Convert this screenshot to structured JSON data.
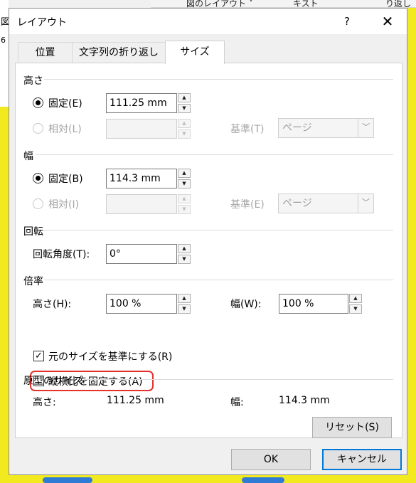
{
  "background": {
    "ribbon_item_1": "図のレイアウト ˅",
    "ribbon_item_2": "キスト",
    "ribbon_item_3": "り返し",
    "left_chars": [
      "図",
      "6"
    ]
  },
  "dialog": {
    "title": "レイアウト",
    "help_label": "?",
    "close_label": "✕"
  },
  "tabs": [
    {
      "label": "位置"
    },
    {
      "label": "文字列の折り返し"
    },
    {
      "label": "サイズ"
    }
  ],
  "height_section": {
    "title": "高さ",
    "fixed_label": "固定(E)",
    "fixed_value": "111.25 mm",
    "relative_label": "相対(L)",
    "relative_value": "",
    "base_label": "基準(T)",
    "base_value": "ページ"
  },
  "width_section": {
    "title": "幅",
    "fixed_label": "固定(B)",
    "fixed_value": "114.3 mm",
    "relative_label": "相対(I)",
    "relative_value": "",
    "base_label": "基準(E)",
    "base_value": "ページ"
  },
  "rotation_section": {
    "title": "回転",
    "angle_label": "回転角度(T):",
    "angle_value": "0°"
  },
  "scale_section": {
    "title": "倍率",
    "height_label": "高さ(H):",
    "height_value": "100 %",
    "width_label": "幅(W):",
    "width_value": "100 %",
    "lock_aspect_label": "縦横比を固定する(A)",
    "lock_aspect_checked": false,
    "relative_original_label": "元のサイズを基準にする(R)",
    "relative_original_checked": true
  },
  "original_size_section": {
    "title": "原型のサイズ",
    "height_label": "高さ:",
    "height_value": "111.25 mm",
    "width_label": "幅:",
    "width_value": "114.3 mm"
  },
  "buttons": {
    "reset": "リセット(S)",
    "ok": "OK",
    "cancel": "キャンセル"
  },
  "icons": {
    "spin_up": "▲",
    "spin_down": "▼",
    "dropdown": "﹀",
    "check": "✓"
  },
  "colors": {
    "highlight": "#e5312b",
    "focus": "#0078d7",
    "background_doc": "#f2ea1e"
  }
}
